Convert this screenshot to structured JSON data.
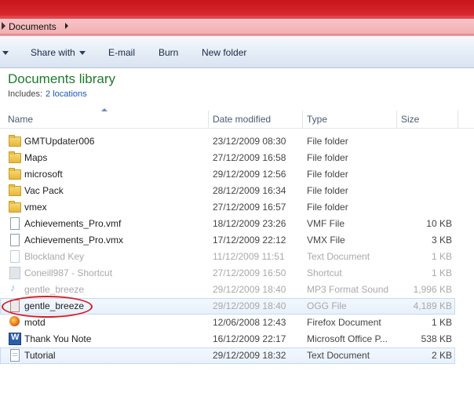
{
  "address": {
    "crumb": "Documents"
  },
  "toolbar": {
    "share_with": "Share with",
    "email": "E-mail",
    "burn": "Burn",
    "new_folder": "New folder"
  },
  "library": {
    "title": "Documents library",
    "includes_label": "Includes:",
    "locations_link": "2 locations"
  },
  "columns": {
    "name": "Name",
    "date": "Date modified",
    "type": "Type",
    "size": "Size"
  },
  "files": [
    {
      "name": "GMTUpdater006",
      "date": "23/12/2009 08:30",
      "type": "File folder",
      "size": "",
      "icon": "folder-icon"
    },
    {
      "name": "Maps",
      "date": "27/12/2009 16:58",
      "type": "File folder",
      "size": "",
      "icon": "folder-icon"
    },
    {
      "name": "microsoft",
      "date": "29/12/2009 12:56",
      "type": "File folder",
      "size": "",
      "icon": "folder-icon"
    },
    {
      "name": "Vac Pack",
      "date": "28/12/2009 16:34",
      "type": "File folder",
      "size": "",
      "icon": "folder-icon"
    },
    {
      "name": "vmex",
      "date": "27/12/2009 16:57",
      "type": "File folder",
      "size": "",
      "icon": "folder-icon"
    },
    {
      "name": "Achievements_Pro.vmf",
      "date": "18/12/2009 23:26",
      "type": "VMF File",
      "size": "10 KB",
      "icon": "document-icon"
    },
    {
      "name": "Achievements_Pro.vmx",
      "date": "17/12/2009 22:12",
      "type": "VMX File",
      "size": "3 KB",
      "icon": "document-icon"
    },
    {
      "name": "Blockland Key",
      "date": "11/12/2009 11:51",
      "type": "Text Document",
      "size": "1 KB",
      "icon": "document-icon"
    },
    {
      "name": "Coneill987 - Shortcut",
      "date": "27/12/2009 16:50",
      "type": "Shortcut",
      "size": "1 KB",
      "icon": "shortcut-icon"
    },
    {
      "name": "gentle_breeze",
      "date": "29/12/2009 18:40",
      "type": "MP3 Format Sound",
      "size": "1,996 KB",
      "icon": "music-icon"
    },
    {
      "name": "gentle_breeze",
      "date": "29/12/2009 18:40",
      "type": "OGG File",
      "size": "4,189 KB",
      "icon": "ogg-file-icon"
    },
    {
      "name": "motd",
      "date": "12/06/2008 12:43",
      "type": "Firefox Document",
      "size": "1 KB",
      "icon": "firefox-icon"
    },
    {
      "name": "Thank You Note",
      "date": "16/12/2009 22:17",
      "type": "Microsoft Office P...",
      "size": "538 KB",
      "icon": "word-doc-icon"
    },
    {
      "name": "Tutorial",
      "date": "29/12/2009 18:32",
      "type": "Text Document",
      "size": "2 KB",
      "icon": "text-doc-icon"
    }
  ],
  "colors": {
    "title_bar": "#c8141a",
    "library_title": "#1e7a2e",
    "link": "#1a58b6",
    "annotation": "#d51e24"
  }
}
